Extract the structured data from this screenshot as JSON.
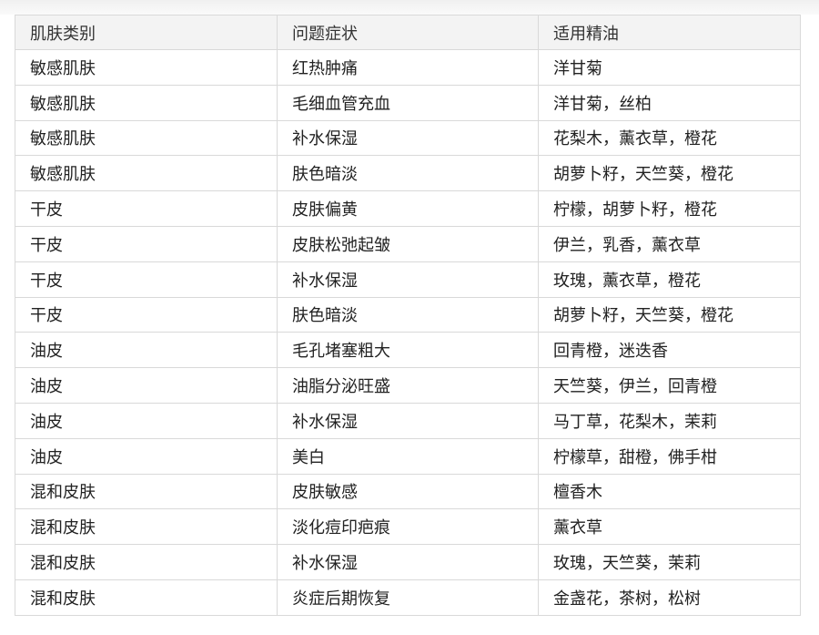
{
  "table": {
    "headers": [
      "肌肤类别",
      "问题症状",
      "适用精油"
    ],
    "rows": [
      [
        "敏感肌肤",
        "红热肿痛",
        "洋甘菊"
      ],
      [
        "敏感肌肤",
        "毛细血管充血",
        "洋甘菊，丝柏"
      ],
      [
        "敏感肌肤",
        "补水保湿",
        "花梨木，薰衣草，橙花"
      ],
      [
        "敏感肌肤",
        "肤色暗淡",
        "胡萝卜籽，天竺葵，橙花"
      ],
      [
        "干皮",
        "皮肤偏黄",
        "柠檬，胡萝卜籽，橙花"
      ],
      [
        "干皮",
        "皮肤松弛起皱",
        "伊兰，乳香，薰衣草"
      ],
      [
        "干皮",
        "补水保湿",
        "玫瑰，薰衣草，橙花"
      ],
      [
        "干皮",
        "肤色暗淡",
        "胡萝卜籽，天竺葵，橙花"
      ],
      [
        "油皮",
        "毛孔堵塞粗大",
        "回青橙，迷迭香"
      ],
      [
        "油皮",
        "油脂分泌旺盛",
        "天竺葵，伊兰，回青橙"
      ],
      [
        "油皮",
        "补水保湿",
        "马丁草，花梨木，茉莉"
      ],
      [
        "油皮",
        "美白",
        "柠檬草，甜橙，佛手柑"
      ],
      [
        "混和皮肤",
        "皮肤敏感",
        "檀香木"
      ],
      [
        "混和皮肤",
        "淡化痘印疤痕",
        "薰衣草"
      ],
      [
        "混和皮肤",
        "补水保湿",
        "玫瑰，天竺葵，茉莉"
      ],
      [
        "混和皮肤",
        "炎症后期恢复",
        "金盏花，茶树，松树"
      ]
    ]
  }
}
